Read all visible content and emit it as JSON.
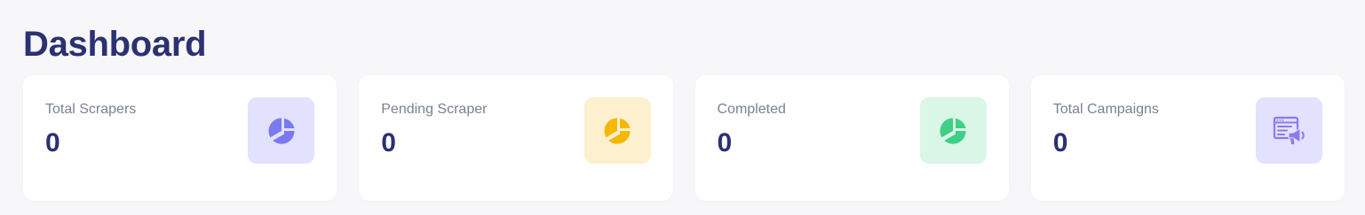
{
  "page": {
    "title": "Dashboard"
  },
  "cards": [
    {
      "label": "Total Scrapers",
      "value": "0",
      "icon": "pie-chart-icon",
      "icon_color": "#7b79f0",
      "icon_bg": "#e2e1fe"
    },
    {
      "label": "Pending Scraper",
      "value": "0",
      "icon": "pie-chart-icon",
      "icon_color": "#f5b800",
      "icon_bg": "#fdf0cf"
    },
    {
      "label": "Completed",
      "value": "0",
      "icon": "pie-chart-icon",
      "icon_color": "#3fcf86",
      "icon_bg": "#d9f6e7"
    },
    {
      "label": "Total Campaigns",
      "value": "0",
      "icon": "campaign-megaphone-icon",
      "icon_color": "#8a7bf0",
      "icon_bg": "#e2e1fe"
    }
  ]
}
